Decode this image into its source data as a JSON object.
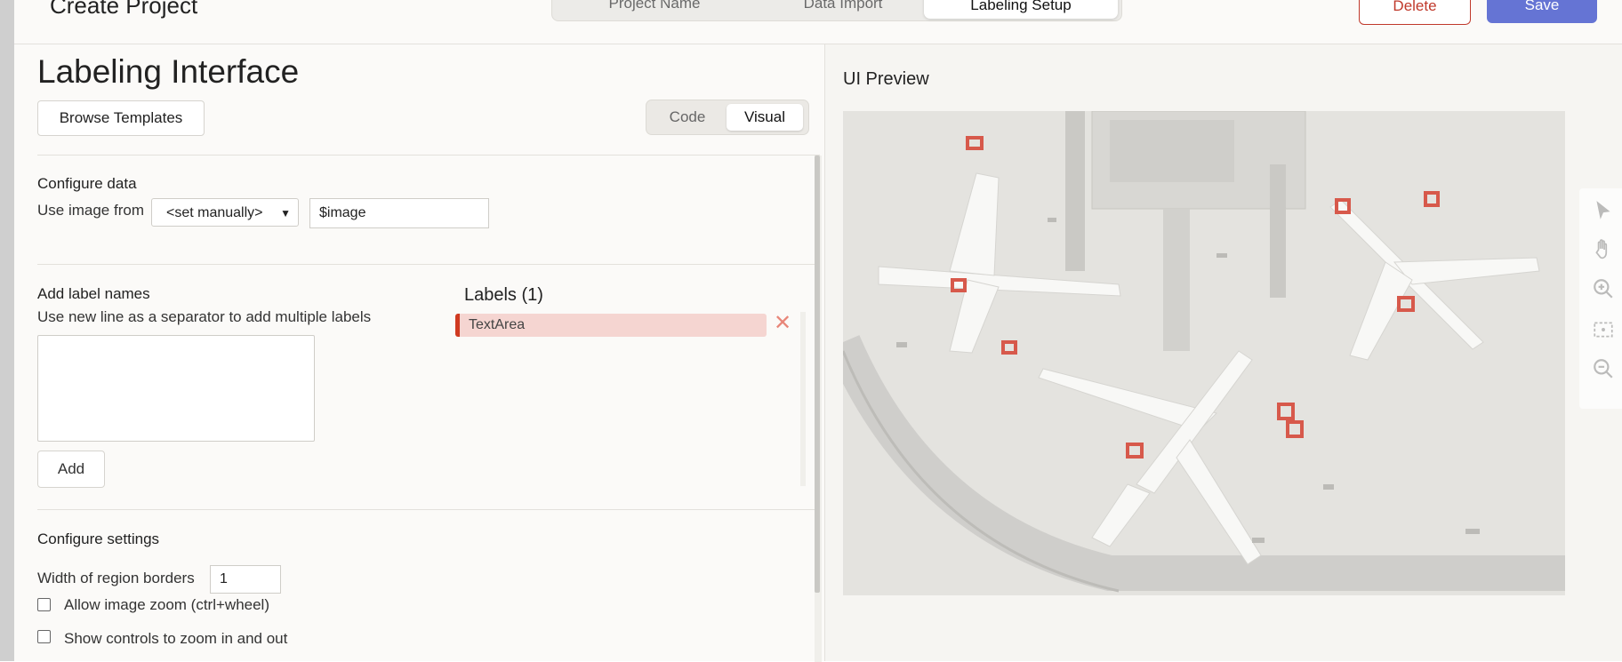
{
  "header": {
    "title": "Create Project",
    "steps": [
      "Project Name",
      "Data Import",
      "Labeling Setup"
    ],
    "active_step": "Labeling Setup",
    "delete_label": "Delete",
    "save_label": "Save"
  },
  "config": {
    "title": "Labeling Interface",
    "browse_label": "Browse Templates",
    "modes": [
      "Code",
      "Visual"
    ],
    "active_mode": "Visual",
    "configure_data": {
      "title": "Configure data",
      "use_image_from": "Use image from",
      "select_value": "<set manually>",
      "image_value": "$image"
    },
    "add_labels": {
      "title": "Add label names",
      "hint": "Use new line as a separator to add multiple labels",
      "textarea_value": "",
      "add_label": "Add"
    },
    "labels": {
      "title": "Labels (1)",
      "items": [
        {
          "name": "TextArea",
          "color": "#d03a21"
        }
      ]
    },
    "settings": {
      "title": "Configure settings",
      "width_label": "Width of region borders",
      "width_value": "1",
      "zoom_label": "Allow image zoom (ctrl+wheel)",
      "controls_label": "Show controls to zoom in and out",
      "zoom_checked": false,
      "controls_checked": false
    }
  },
  "preview": {
    "title": "UI Preview",
    "image_description": "aerial airport image",
    "tools": [
      "pointer-icon",
      "hand-icon",
      "zoom-in-icon",
      "fit-icon",
      "zoom-out-icon"
    ]
  },
  "colors": {
    "accent": "#6574d4",
    "danger": "#c0392b",
    "label": "#d03a21"
  }
}
